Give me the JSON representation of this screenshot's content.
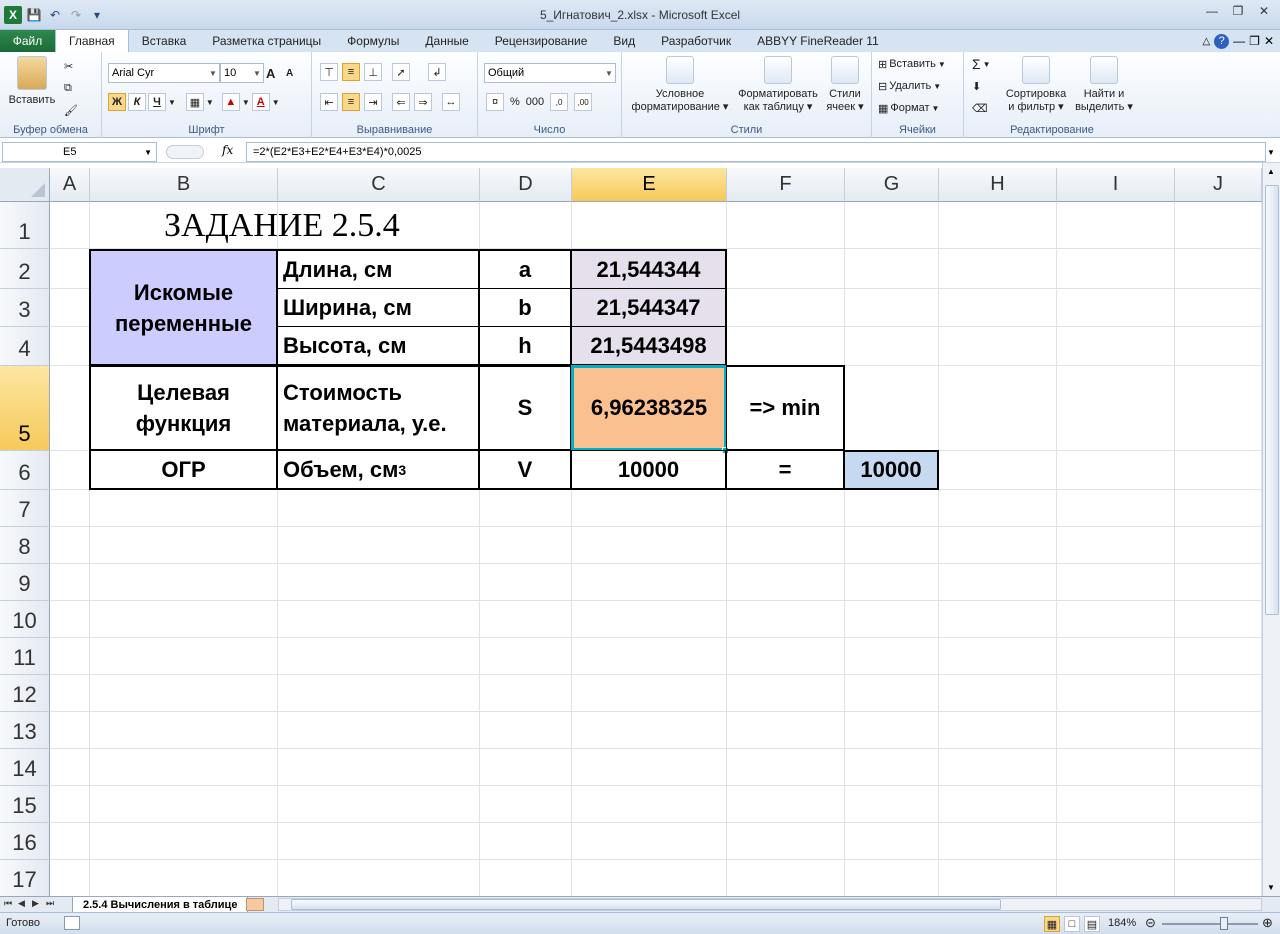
{
  "window": {
    "title": "5_Игнатович_2.xlsx - Microsoft Excel"
  },
  "tabs": {
    "file": "Файл",
    "home": "Главная",
    "insert": "Вставка",
    "layout": "Разметка страницы",
    "formulas": "Формулы",
    "data": "Данные",
    "review": "Рецензирование",
    "view": "Вид",
    "developer": "Разработчик",
    "abbyy": "ABBYY FineReader 11"
  },
  "ribbon": {
    "clipboard": {
      "paste": "Вставить",
      "label": "Буфер обмена"
    },
    "font": {
      "name": "Arial Cyr",
      "size": "10",
      "bold": "Ж",
      "italic": "К",
      "underline": "Ч",
      "grow": "A",
      "shrink": "A",
      "color": "A",
      "label": "Шрифт"
    },
    "alignment": {
      "label": "Выравнивание"
    },
    "number": {
      "format": "Общий",
      "percent": "%",
      "thousands": "000",
      "label": "Число"
    },
    "styles": {
      "conditional_1": "Условное",
      "conditional_2": "форматирование",
      "table_1": "Форматировать",
      "table_2": "как таблицу",
      "cell_1": "Стили",
      "cell_2": "ячеек",
      "label": "Стили"
    },
    "cells": {
      "insert": "Вставить",
      "delete": "Удалить",
      "format": "Формат",
      "label": "Ячейки"
    },
    "editing": {
      "sigma": "Σ",
      "sort_1": "Сортировка",
      "sort_2": "и фильтр",
      "find_1": "Найти и",
      "find_2": "выделить",
      "label": "Редактирование"
    }
  },
  "formula_bar": {
    "name_box": "E5",
    "fx": "fx",
    "formula": "=2*(E2*E3+E2*E4+E3*E4)*0,0025"
  },
  "columns": [
    "A",
    "B",
    "C",
    "D",
    "E",
    "F",
    "G",
    "H",
    "I",
    "J"
  ],
  "rows": [
    "1",
    "2",
    "3",
    "4",
    "5",
    "6",
    "7",
    "8",
    "9",
    "10",
    "11",
    "12",
    "13",
    "14",
    "15",
    "16",
    "17"
  ],
  "sheet": {
    "title": "ЗАДАНИЕ 2.5.4",
    "var_label_1": "Искомые",
    "var_label_2": "переменные",
    "length": "Длина, см",
    "width": "Ширина, см",
    "height": "Высота, см",
    "a": "a",
    "b": "b",
    "h": "h",
    "val_a": "21,544344",
    "val_b": "21,544347",
    "val_h": "21,5443498",
    "target_1": "Целевая",
    "target_2": "функция",
    "cost_1": "Стоимость",
    "cost_2": "материала, у.е.",
    "s": "S",
    "val_s": "6,96238325",
    "min": "=> min",
    "ogr": "ОГР",
    "volume": "Объем, см",
    "volume_sup": "3",
    "v": "V",
    "val_v": "10000",
    "eq": "=",
    "val_limit": "10000"
  },
  "sheet_tabs": {
    "active": "2.5.4 Вычисления в таблице"
  },
  "status": {
    "ready": "Готово",
    "zoom": "184%"
  },
  "colors": {
    "blue_fill": "#ccccff",
    "lavender_fill": "#e6e0ec",
    "orange_fill": "#fac090",
    "light_blue_fill": "#c5d9f1",
    "selection": "#00b0c8"
  }
}
